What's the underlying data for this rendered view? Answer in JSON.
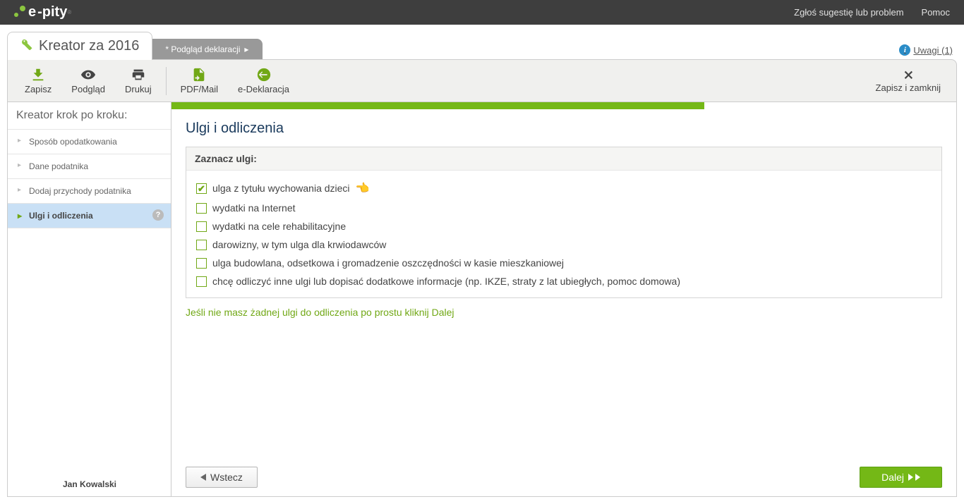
{
  "header": {
    "logo_prefix": "e",
    "logo_text": "-pity",
    "link_suggest": "Zgłoś sugestię lub problem",
    "link_help": "Pomoc"
  },
  "tabs": {
    "main": "Kreator za 2016",
    "preview": "* Podgląd deklaracji",
    "notes": "Uwagi (1)"
  },
  "toolbar": {
    "save": "Zapisz",
    "preview": "Podgląd",
    "print": "Drukuj",
    "pdf": "PDF/Mail",
    "edecl": "e-Deklaracja",
    "close": "Zapisz i zamknij"
  },
  "sidebar": {
    "title": "Kreator krok po kroku:",
    "items": [
      "Sposób opodatkowania",
      "Dane podatnika",
      "Dodaj przychody podatnika",
      "Ulgi i odliczenia"
    ],
    "footer": "Jan Kowalski"
  },
  "content": {
    "title": "Ulgi i odliczenia",
    "section_header": "Zaznacz ulgi:",
    "checks": [
      {
        "label": "ulga z tytułu wychowania dzieci",
        "checked": true,
        "hand": true
      },
      {
        "label": "wydatki na Internet",
        "checked": false,
        "hand": false
      },
      {
        "label": "wydatki na cele rehabilitacyjne",
        "checked": false,
        "hand": false
      },
      {
        "label": "darowizny, w tym ulga dla krwiodawców",
        "checked": false,
        "hand": false
      },
      {
        "label": "ulga budowlana, odsetkowa i gromadzenie oszczędności w kasie mieszkaniowej",
        "checked": false,
        "hand": false
      },
      {
        "label": "chcę odliczyć inne ulgi lub dopisać dodatkowe informacje (np. IKZE, straty z lat ubiegłych, pomoc domowa)",
        "checked": false,
        "hand": false
      }
    ],
    "hint": "Jeśli nie masz żadnej ulgi do odliczenia po prostu kliknij Dalej",
    "back": "Wstecz",
    "next": "Dalej"
  }
}
